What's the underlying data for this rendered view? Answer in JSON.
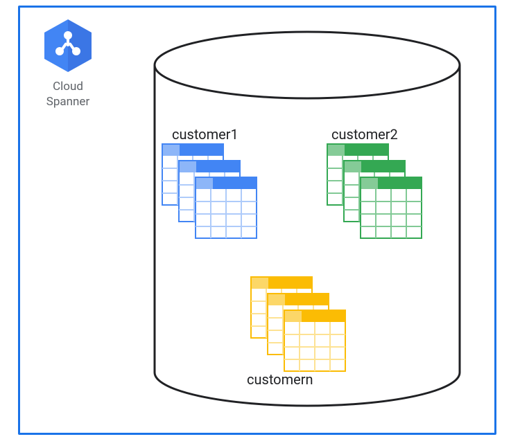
{
  "product": {
    "name": "Cloud\nSpanner",
    "icon_name": "cloud-spanner"
  },
  "customers": [
    {
      "id": "c1",
      "label": "customer1",
      "color_header": "#4285F4",
      "color_grid": "#AECBFA"
    },
    {
      "id": "c2",
      "label": "customer2",
      "color_header": "#34A853",
      "color_grid": "#81C995"
    },
    {
      "id": "cn",
      "label": "customern",
      "color_header": "#FBBC04",
      "color_grid": "#FDE293"
    }
  ]
}
